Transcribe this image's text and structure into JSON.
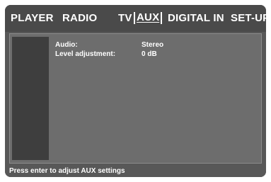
{
  "menu": {
    "items": [
      {
        "label": "PLAYER"
      },
      {
        "label": "RADIO"
      },
      {
        "label": "TV"
      },
      {
        "label": "AUX",
        "selected": true
      },
      {
        "label": "DIGITAL IN"
      },
      {
        "label": "SET-UP"
      }
    ]
  },
  "settings": {
    "audio_label": "Audio:",
    "audio_value": "Stereo",
    "level_label": "Level adjustment:",
    "level_value": "0 dB"
  },
  "status": {
    "text": "Press enter to adjust AUX settings"
  },
  "colors": {
    "background": "#585858",
    "menubar": "#4a4a4a",
    "panel": "#6d6d6d",
    "sidebar": "#3e3e3e",
    "text": "#ffffff"
  }
}
